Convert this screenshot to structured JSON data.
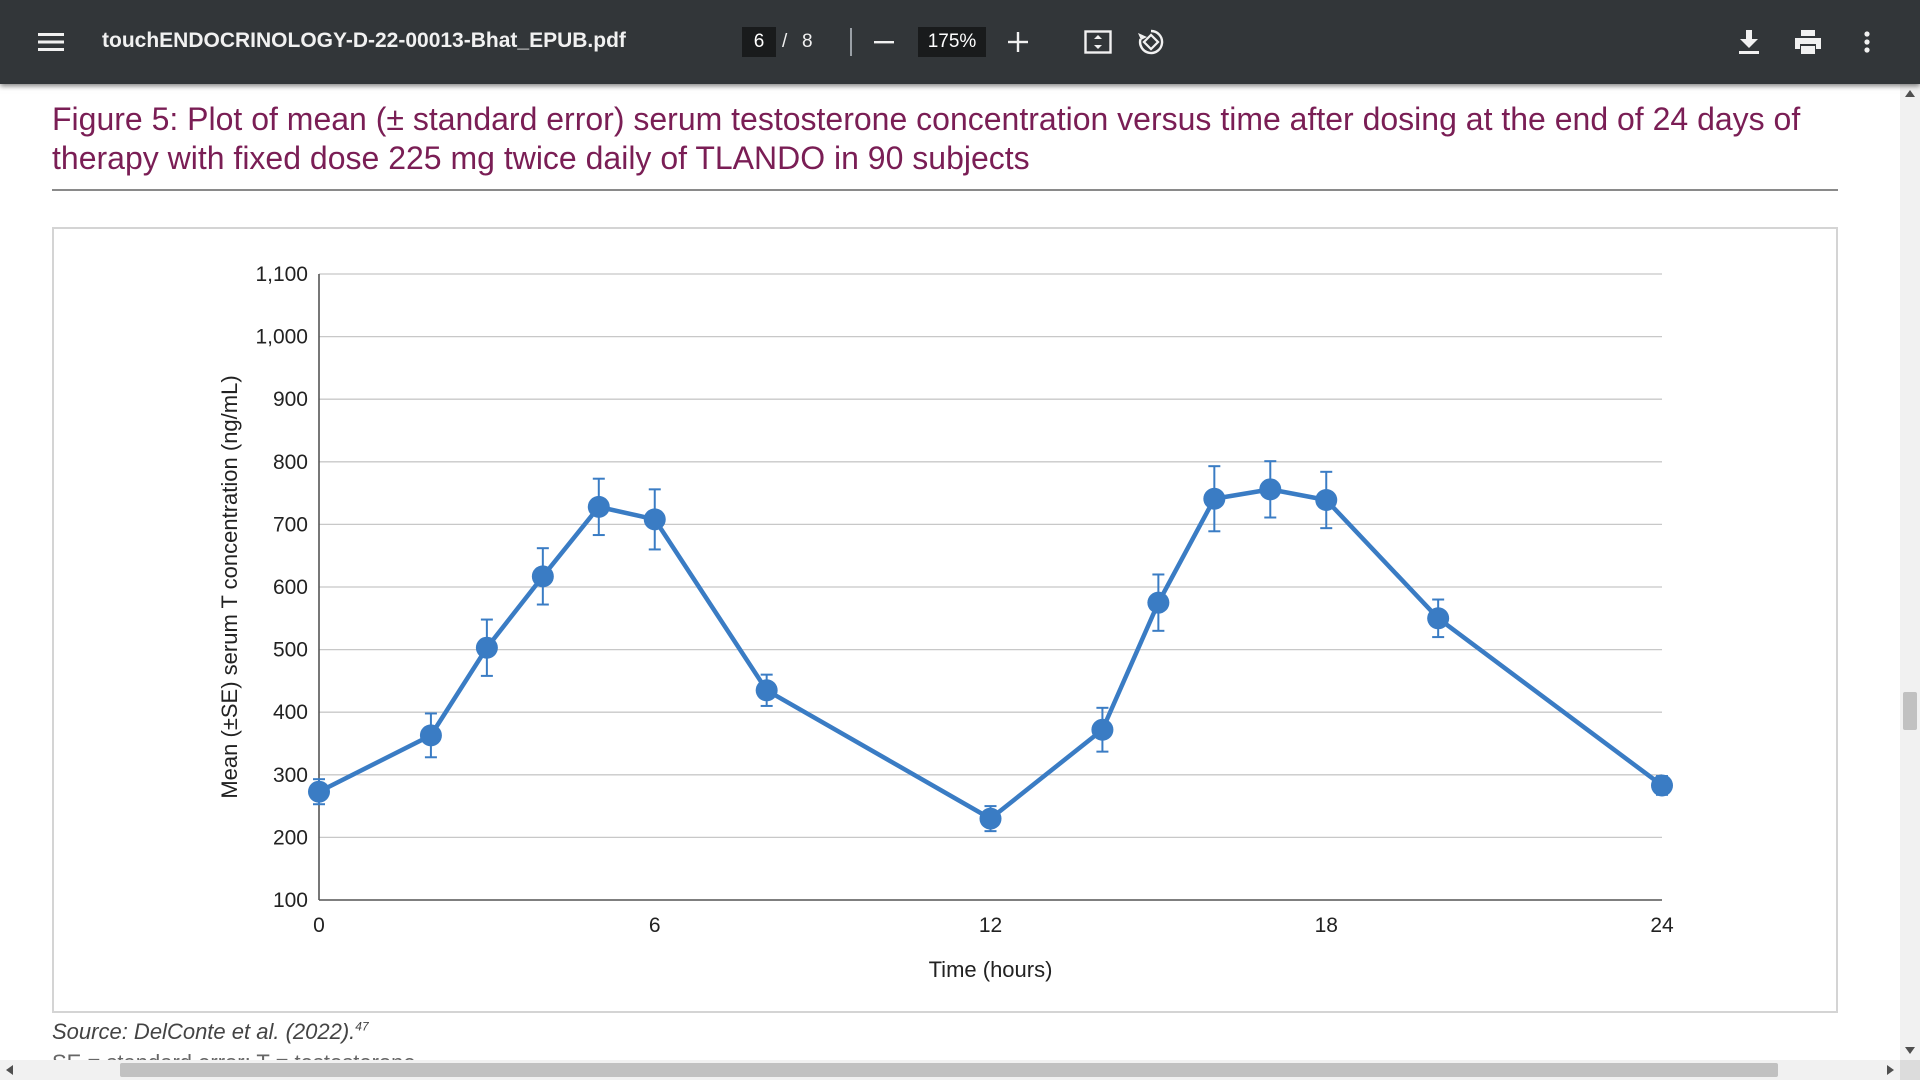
{
  "toolbar": {
    "file_name": "touchENDOCRINOLOGY-D-22-00013-Bhat_EPUB.pdf",
    "current_page": "6",
    "page_separator": "/",
    "total_pages": "8",
    "zoom": "175%",
    "icons": [
      "menu-icon",
      "zoom-out-icon",
      "zoom-in-icon",
      "fit-page-icon",
      "rotate-icon",
      "download-icon",
      "print-icon",
      "more-options-icon"
    ],
    "background_color": "#323639"
  },
  "document": {
    "figure_title": "Figure 5: Plot of mean (± standard error) serum testosterone concentration versus time after dosing at the end of 24 days of therapy with fixed dose 225 mg twice daily of TLANDO in 90 subjects",
    "source_text": "Source: DelConte et al. (2022).",
    "source_ref": "47",
    "cut_off_text": "SE = standard error; T = testosterone.",
    "title_color": "#7a1e55"
  },
  "chart_data": {
    "type": "line",
    "title": "",
    "xlabel": "Time (hours)",
    "ylabel": "Mean (±SE) serum T concentration (ng/mL)",
    "xlim": [
      0,
      24
    ],
    "ylim": [
      100,
      1100
    ],
    "xticks": [
      0,
      6,
      12,
      18,
      24
    ],
    "yticks": [
      100,
      200,
      300,
      400,
      500,
      600,
      700,
      800,
      900,
      1000,
      1100
    ],
    "ytick_labels": [
      "100",
      "200",
      "300",
      "400",
      "500",
      "600",
      "700",
      "800",
      "900",
      "1,000",
      "1,100"
    ],
    "grid": true,
    "color": "#3a7cc4",
    "series": [
      {
        "x": [
          0,
          2,
          3,
          4,
          5,
          6,
          8,
          12,
          14,
          15,
          16,
          17,
          18,
          20,
          24
        ],
        "y": [
          273,
          363,
          503,
          617,
          728,
          708,
          435,
          230,
          372,
          575,
          741,
          756,
          739,
          550,
          283
        ],
        "err": [
          20,
          35,
          45,
          45,
          45,
          48,
          25,
          20,
          35,
          45,
          52,
          45,
          45,
          30,
          15
        ]
      }
    ]
  }
}
